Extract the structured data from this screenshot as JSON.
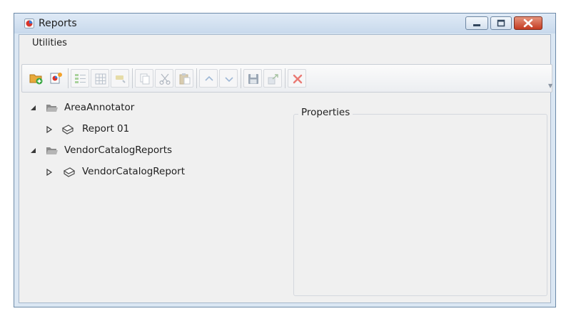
{
  "window": {
    "title": "Reports"
  },
  "menu": {
    "items": [
      "Utilities"
    ]
  },
  "toolbar": {
    "buttons": [
      {
        "icon": "add-folder-icon",
        "enabled": true
      },
      {
        "icon": "new-report-icon",
        "enabled": true
      },
      {
        "icon": "list-view-icon",
        "enabled": false
      },
      {
        "icon": "grid-icon",
        "enabled": false
      },
      {
        "icon": "link-icon",
        "enabled": false
      },
      {
        "icon": "copy-icon",
        "enabled": false
      },
      {
        "icon": "cut-icon",
        "enabled": false
      },
      {
        "icon": "paste-icon",
        "enabled": false
      },
      {
        "icon": "move-up-icon",
        "enabled": false
      },
      {
        "icon": "move-down-icon",
        "enabled": false
      },
      {
        "icon": "save-icon",
        "enabled": false
      },
      {
        "icon": "export-icon",
        "enabled": false
      },
      {
        "icon": "delete-icon",
        "enabled": false
      }
    ]
  },
  "tree": {
    "nodes": [
      {
        "label": "AreaAnnotator",
        "type": "folder",
        "expanded": true
      },
      {
        "label": "Report 01",
        "type": "report",
        "expanded": false
      },
      {
        "label": "VendorCatalogReports",
        "type": "folder",
        "expanded": true
      },
      {
        "label": "VendorCatalogReport",
        "type": "report",
        "expanded": false
      }
    ]
  },
  "properties": {
    "title": "Properties"
  },
  "colors": {
    "title_bar": "#c8d9ec",
    "client_bg": "#f0f0f0",
    "close_button": "#c43b22",
    "delete_icon": "#e8524a"
  }
}
